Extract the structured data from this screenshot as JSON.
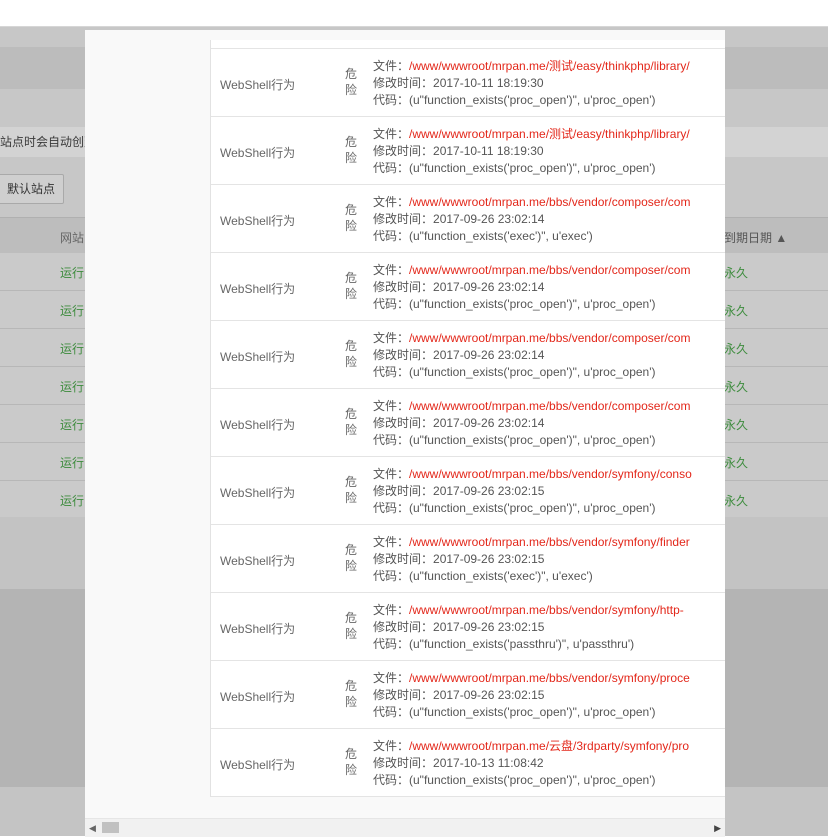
{
  "background": {
    "notice_text": "站点时会自动创建",
    "default_site_button": "默认站点",
    "table_headers": {
      "site": "网站",
      "expiry": "到期日期 ▲"
    },
    "rows": [
      {
        "status": "运行",
        "expiry": "永久"
      },
      {
        "status": "运行",
        "expiry": "永久"
      },
      {
        "status": "运行",
        "expiry": "永久"
      },
      {
        "status": "运行",
        "expiry": "永久"
      },
      {
        "status": "运行",
        "expiry": "永久"
      },
      {
        "status": "运行",
        "expiry": "永久"
      },
      {
        "status": "运行",
        "expiry": "永久"
      }
    ]
  },
  "labels": {
    "file": "文件：",
    "mtime": "修改时间：",
    "code": "代码："
  },
  "results": [
    {
      "type": "WebShell行为",
      "level": "危险",
      "file": "/www/wwwroot/mrpan.me/测试/easy/thinkphp/library/",
      "mtime": "2017-10-11 18:19:30",
      "code": "(u\"function_exists('proc_open')\", u'proc_open')"
    },
    {
      "type": "WebShell行为",
      "level": "危险",
      "file": "/www/wwwroot/mrpan.me/测试/easy/thinkphp/library/",
      "mtime": "2017-10-11 18:19:30",
      "code": "(u\"function_exists('proc_open')\", u'proc_open')"
    },
    {
      "type": "WebShell行为",
      "level": "危险",
      "file": "/www/wwwroot/mrpan.me/bbs/vendor/composer/com",
      "mtime": "2017-09-26 23:02:14",
      "code": "(u\"function_exists('exec')\", u'exec')"
    },
    {
      "type": "WebShell行为",
      "level": "危险",
      "file": "/www/wwwroot/mrpan.me/bbs/vendor/composer/com",
      "mtime": "2017-09-26 23:02:14",
      "code": "(u\"function_exists('proc_open')\", u'proc_open')"
    },
    {
      "type": "WebShell行为",
      "level": "危险",
      "file": "/www/wwwroot/mrpan.me/bbs/vendor/composer/com",
      "mtime": "2017-09-26 23:02:14",
      "code": "(u\"function_exists('proc_open')\", u'proc_open')"
    },
    {
      "type": "WebShell行为",
      "level": "危险",
      "file": "/www/wwwroot/mrpan.me/bbs/vendor/composer/com",
      "mtime": "2017-09-26 23:02:14",
      "code": "(u\"function_exists('proc_open')\", u'proc_open')"
    },
    {
      "type": "WebShell行为",
      "level": "危险",
      "file": "/www/wwwroot/mrpan.me/bbs/vendor/symfony/conso",
      "mtime": "2017-09-26 23:02:15",
      "code": "(u\"function_exists('proc_open')\", u'proc_open')"
    },
    {
      "type": "WebShell行为",
      "level": "危险",
      "file": "/www/wwwroot/mrpan.me/bbs/vendor/symfony/finder",
      "mtime": "2017-09-26 23:02:15",
      "code": "(u\"function_exists('exec')\", u'exec')"
    },
    {
      "type": "WebShell行为",
      "level": "危险",
      "file": "/www/wwwroot/mrpan.me/bbs/vendor/symfony/http-",
      "mtime": "2017-09-26 23:02:15",
      "code": "(u\"function_exists('passthru')\", u'passthru')"
    },
    {
      "type": "WebShell行为",
      "level": "危险",
      "file": "/www/wwwroot/mrpan.me/bbs/vendor/symfony/proce",
      "mtime": "2017-09-26 23:02:15",
      "code": "(u\"function_exists('proc_open')\", u'proc_open')"
    },
    {
      "type": "WebShell行为",
      "level": "危险",
      "file": "/www/wwwroot/mrpan.me/云盘/3rdparty/symfony/pro",
      "mtime": "2017-10-13 11:08:42",
      "code": "(u\"function_exists('proc_open')\", u'proc_open')"
    }
  ],
  "scrollbar": {
    "left_arrow": "◀",
    "right_arrow": "▶"
  }
}
